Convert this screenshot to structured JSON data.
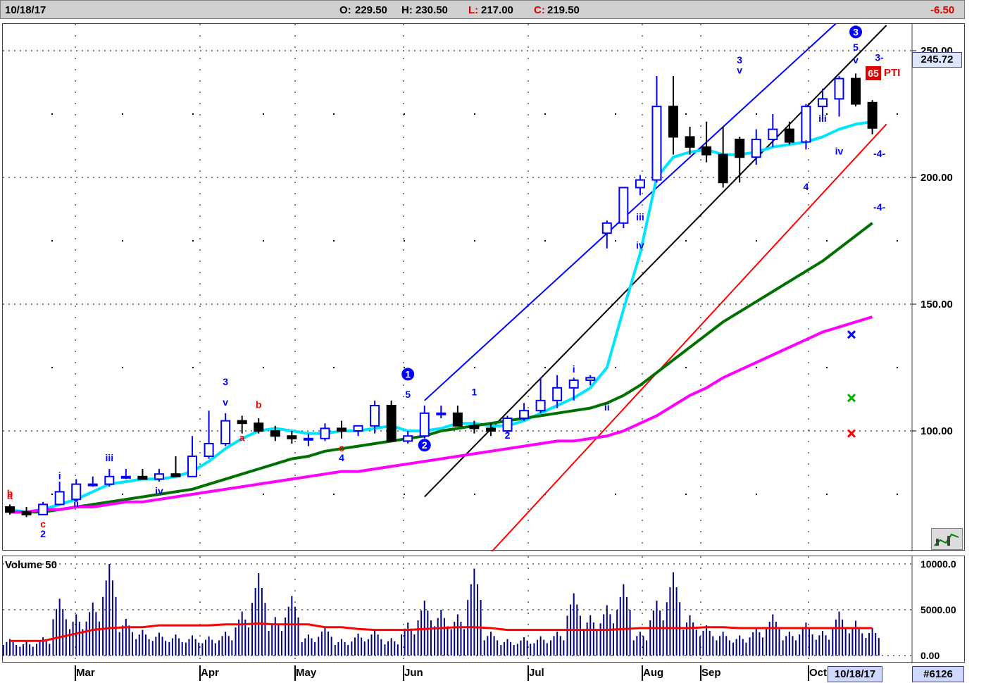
{
  "header": {
    "date": "10/18/17",
    "open_label": "O:",
    "open": "229.50",
    "high_label": "H:",
    "high": "230.50",
    "low_label": "L:",
    "low": "217.00",
    "close_label": "C:",
    "close": "219.50",
    "change": "-6.50"
  },
  "price_panel": {
    "last_price": "245.72",
    "pti_value": "65",
    "pti_label": "PTI",
    "grid_dotted": true,
    "colors": {
      "up_bar": "#0000ff",
      "down_bar": "#000000",
      "ma_short": "#00e5ff",
      "ma_mid": "#007000",
      "ma_long": "#ff00ff",
      "channel_blue": "#0000ff",
      "channel_black": "#000000",
      "channel_red": "#ff0000",
      "wave_label": "#0000ff",
      "corrective_label": "#ff0000",
      "target_blue": "#0000ff",
      "target_green": "#00b000",
      "target_red": "#ff0000"
    }
  },
  "volume_panel": {
    "title": "Volume 50",
    "colors": {
      "bars": "#000080",
      "ma": "#ff0000"
    }
  },
  "footer": {
    "date_badge": "10/18/17",
    "id_badge": "#6126"
  },
  "chart_data": {
    "type": "bar",
    "subtype": "ohlc-price-with-volume",
    "x_labels": [
      "Mar",
      "Apr",
      "May",
      "Jun",
      "Jul",
      "Aug",
      "Sep",
      "Oct"
    ],
    "y_ticks": [
      "250.00",
      "200.00",
      "150.00",
      "100.00"
    ],
    "ylim": [
      52,
      260
    ],
    "volume_ticks": [
      "10000.0",
      "5000.00",
      "0.00"
    ],
    "volume_ylim": [
      0,
      11000
    ],
    "x": [
      "Feb 15",
      "Feb 20",
      "Feb 24",
      "Mar 1",
      "Mar 6",
      "Mar 10",
      "Mar 15",
      "Mar 20",
      "Mar 24",
      "Mar 29",
      "Apr 3",
      "Apr 7",
      "Apr 12",
      "Apr 18",
      "Apr 21",
      "Apr 26",
      "May 1",
      "May 5",
      "May 10",
      "May 15",
      "May 19",
      "May 24",
      "May 30",
      "Jun 5",
      "Jun 9",
      "Jun 14",
      "Jun 19",
      "Jun 23",
      "Jun 28",
      "Jul 3",
      "Jul 7",
      "Jul 12",
      "Jul 17",
      "Jul 21",
      "Jul 26",
      "Jul 31",
      "Aug 4",
      "Aug 9",
      "Aug 14",
      "Aug 18",
      "Aug 23",
      "Aug 28",
      "Sep 1",
      "Sep 6",
      "Sep 11",
      "Sep 15",
      "Sep 20",
      "Sep 25",
      "Sep 29",
      "Oct 4",
      "Oct 9",
      "Oct 13",
      "Oct 18"
    ],
    "series": [
      {
        "name": "Price",
        "type": "ohlc",
        "open": [
          70,
          68,
          67,
          71,
          73,
          79,
          79,
          82,
          82,
          81,
          83,
          82,
          90,
          95,
          104,
          103,
          100,
          98,
          97,
          97,
          101,
          100,
          102,
          110,
          96,
          98,
          107,
          107,
          102,
          101,
          100,
          105,
          108,
          112,
          117,
          120,
          178,
          182,
          196,
          199,
          228,
          216,
          212,
          209,
          215,
          208,
          215,
          219,
          214,
          228,
          231,
          239,
          229.5
        ],
        "high": [
          71,
          70,
          72,
          80,
          81,
          82,
          85,
          85,
          85,
          85,
          90,
          98,
          108,
          107,
          106,
          105,
          102,
          100,
          99,
          103,
          104,
          102,
          112,
          112,
          100,
          110,
          110,
          110,
          104,
          103,
          106,
          111,
          121,
          122,
          121,
          122,
          183,
          196,
          201,
          240,
          240,
          220,
          222,
          220,
          216,
          219,
          225,
          222,
          229,
          235,
          240,
          241,
          230.5
        ],
        "low": [
          67,
          66,
          67,
          71,
          72,
          78,
          78,
          81,
          81,
          80,
          82,
          82,
          89,
          94,
          99,
          99,
          96,
          95,
          94,
          96,
          97,
          98,
          99,
          96,
          95,
          97,
          105,
          104,
          99,
          98,
          99,
          104,
          107,
          109,
          112,
          118,
          172,
          180,
          193,
          198,
          209,
          209,
          206,
          196,
          198,
          205,
          212,
          213,
          211,
          223,
          224,
          228,
          217
        ],
        "close": [
          68,
          67,
          71,
          76,
          79,
          79,
          82,
          82,
          81,
          83,
          82,
          90,
          95,
          104,
          103,
          100,
          98,
          97,
          97,
          101,
          100,
          102,
          110,
          96,
          98,
          107,
          107,
          102,
          101,
          100,
          105,
          108,
          112,
          117,
          120,
          121,
          182,
          196,
          199,
          228,
          216,
          212,
          209,
          198,
          208,
          215,
          219,
          214,
          228,
          231,
          239,
          229,
          219.5
        ]
      },
      {
        "name": "MA short",
        "type": "line",
        "values": [
          69,
          68,
          69,
          71,
          73,
          76,
          79,
          80,
          81,
          81,
          82,
          84,
          88,
          93,
          97,
          100,
          101,
          100,
          99,
          99,
          100,
          100,
          101,
          102,
          100,
          100,
          101,
          103,
          103,
          102,
          102,
          104,
          107,
          110,
          113,
          117,
          125,
          148,
          170,
          200,
          208,
          210,
          211,
          209,
          209,
          210,
          212,
          213,
          214,
          216,
          219,
          221,
          222
        ]
      },
      {
        "name": "MA mid",
        "type": "line",
        "values": [
          68,
          68,
          68,
          69,
          70,
          71,
          72,
          73,
          74,
          75,
          76,
          77,
          79,
          81,
          83,
          85,
          87,
          89,
          90,
          92,
          93,
          94,
          95,
          96,
          97,
          98,
          100,
          101,
          102,
          103,
          104,
          105,
          106,
          107,
          108,
          109,
          111,
          114,
          118,
          123,
          128,
          133,
          138,
          143,
          147,
          151,
          155,
          159,
          163,
          167,
          172,
          177,
          182
        ]
      },
      {
        "name": "MA long",
        "type": "line",
        "values": [
          68,
          68,
          69,
          69,
          70,
          70,
          71,
          72,
          72,
          73,
          74,
          75,
          76,
          77,
          78,
          79,
          80,
          81,
          82,
          83,
          84,
          84,
          85,
          86,
          87,
          88,
          89,
          90,
          91,
          92,
          93,
          94,
          95,
          96,
          96,
          97,
          98,
          100,
          103,
          106,
          110,
          114,
          117,
          121,
          124,
          127,
          130,
          133,
          136,
          139,
          141,
          143,
          145
        ]
      },
      {
        "name": "Volume",
        "type": "bar",
        "values": [
          1800,
          1500,
          2000,
          6200,
          4500,
          5800,
          10000,
          4000,
          2800,
          2500,
          2300,
          2200,
          2100,
          2600,
          4800,
          9000,
          4200,
          6500,
          2300,
          3200,
          1800,
          2400,
          2800,
          1900,
          3600,
          6000,
          5000,
          4500,
          9500,
          2600,
          1800,
          2000,
          2100,
          2600,
          6800,
          4400,
          5500,
          7800,
          2600,
          6000,
          9100,
          4400,
          3300,
          2600,
          2200,
          3100,
          4500,
          2600,
          3600,
          2700,
          4800,
          3800,
          3000
        ]
      },
      {
        "name": "Volume MA",
        "type": "line",
        "values": [
          1600,
          1600,
          1600,
          2000,
          2400,
          2800,
          3000,
          3100,
          3100,
          3300,
          3300,
          3300,
          3300,
          3400,
          3400,
          3500,
          3400,
          3400,
          3400,
          3100,
          3100,
          2900,
          2800,
          2800,
          2800,
          2900,
          3000,
          3100,
          3100,
          3000,
          2800,
          2800,
          2800,
          2800,
          2800,
          2800,
          2800,
          2900,
          3000,
          3000,
          3000,
          3000,
          3100,
          3100,
          3000,
          3000,
          3000,
          3000,
          3000,
          3000,
          3000,
          3000,
          3000
        ]
      }
    ],
    "annotations": [
      {
        "text": "a",
        "color": "red",
        "x": "Feb 15",
        "y": 73
      },
      {
        "text": "b",
        "color": "red",
        "x": "Feb 15",
        "y": 74
      },
      {
        "text": "c",
        "color": "red",
        "x": "Feb 24",
        "y": 62
      },
      {
        "text": "2",
        "color": "blue",
        "x": "Feb 24",
        "y": 58
      },
      {
        "text": "i",
        "color": "blue",
        "x": "Mar 1",
        "y": 81
      },
      {
        "text": "ii",
        "color": "blue",
        "x": "Mar 6",
        "y": 70
      },
      {
        "text": "iii",
        "color": "blue",
        "x": "Mar 15",
        "y": 88
      },
      {
        "text": "iv",
        "color": "blue",
        "x": "Mar 29",
        "y": 75
      },
      {
        "text": "3",
        "color": "blue",
        "x": "Apr 18",
        "y": 118
      },
      {
        "text": "v",
        "color": "blue",
        "x": "Apr 18",
        "y": 110
      },
      {
        "text": "a",
        "color": "red",
        "x": "Apr 21",
        "y": 96
      },
      {
        "text": "b",
        "color": "red",
        "x": "Apr 26",
        "y": 109
      },
      {
        "text": "c",
        "color": "red",
        "x": "May 19",
        "y": 92
      },
      {
        "text": "4",
        "color": "blue",
        "x": "May 19",
        "y": 88
      },
      {
        "text": "1",
        "color": "blue",
        "x": "Jun 9",
        "y": 121,
        "circled": true
      },
      {
        "text": "5",
        "color": "blue",
        "x": "Jun 9",
        "y": 113
      },
      {
        "text": "2",
        "color": "blue",
        "x": "Jun 14",
        "y": 93,
        "circled": true
      },
      {
        "text": "1",
        "color": "blue",
        "x": "Jun 28",
        "y": 114
      },
      {
        "text": "2",
        "color": "blue",
        "x": "Jul 7",
        "y": 97
      },
      {
        "text": "i",
        "color": "blue",
        "x": "Jul 26",
        "y": 123
      },
      {
        "text": "ii",
        "color": "blue",
        "x": "Aug 4",
        "y": 108
      },
      {
        "text": "iii",
        "color": "blue",
        "x": "Aug 14",
        "y": 183
      },
      {
        "text": "iv",
        "color": "blue",
        "x": "Aug 14",
        "y": 172
      },
      {
        "text": "3",
        "color": "blue",
        "x": "Sep 11",
        "y": 245
      },
      {
        "text": "v",
        "color": "blue",
        "x": "Sep 11",
        "y": 241
      },
      {
        "text": "4",
        "color": "blue",
        "x": "Sep 29",
        "y": 195
      },
      {
        "text": "i",
        "color": "blue",
        "x": "Sep 29",
        "y": 212
      },
      {
        "text": "iii",
        "color": "blue",
        "x": "Oct 4",
        "y": 222
      },
      {
        "text": "iv",
        "color": "blue",
        "x": "Oct 9",
        "y": 209
      },
      {
        "text": "3",
        "color": "blue",
        "x": "Oct 13",
        "y": 256,
        "circled": true
      },
      {
        "text": "5",
        "color": "blue",
        "x": "Oct 13",
        "y": 250
      },
      {
        "text": "v",
        "color": "blue",
        "x": "Oct 13",
        "y": 245
      },
      {
        "text": "3-",
        "color": "blue",
        "x": "Oct 18",
        "y": 246
      },
      {
        "text": "-4-",
        "color": "blue",
        "x": "Oct 18",
        "y": 208
      },
      {
        "text": "-4-",
        "color": "blue",
        "x": "Oct 18",
        "y": 187
      }
    ],
    "trendlines": [
      {
        "color": "blue",
        "from": {
          "x": "Jun 14",
          "y": 112
        },
        "to": {
          "x": "Oct 4",
          "y": 261
        }
      },
      {
        "color": "black",
        "from": {
          "x": "Jun 14",
          "y": 74
        },
        "to": {
          "x": "Oct 18",
          "y": 260
        }
      },
      {
        "color": "red",
        "from": {
          "x": "Jul 3",
          "y": 52
        },
        "to": {
          "x": "Oct 18",
          "y": 221
        }
      }
    ],
    "target_markers": [
      {
        "color": "blue",
        "value": 138
      },
      {
        "color": "green",
        "value": 113
      },
      {
        "color": "red",
        "value": 99
      }
    ]
  }
}
